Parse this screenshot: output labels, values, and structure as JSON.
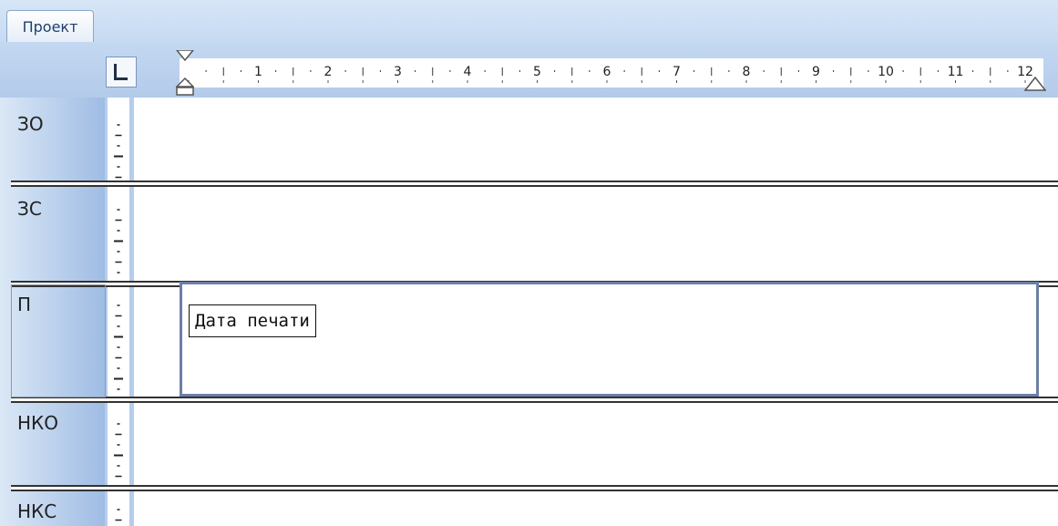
{
  "tabs": [
    {
      "label": "Проект"
    }
  ],
  "ruler": {
    "numbers": [
      "1",
      "2",
      "3",
      "4",
      "5",
      "6",
      "7",
      "8",
      "9",
      "10",
      "11",
      "12"
    ],
    "tab_selector_icon": "left-tab-stop-icon"
  },
  "sections": [
    {
      "label": "ЗО"
    },
    {
      "label": "ЗС"
    },
    {
      "label": "П"
    },
    {
      "label": "НКО"
    },
    {
      "label": "НКС"
    }
  ],
  "field": {
    "text": "Дата печати"
  },
  "colors": {
    "tab_bg": "#c6daf2",
    "ruler_band": "#b3cbea",
    "field_border": "#6c7fa6",
    "separator": "#333333"
  }
}
